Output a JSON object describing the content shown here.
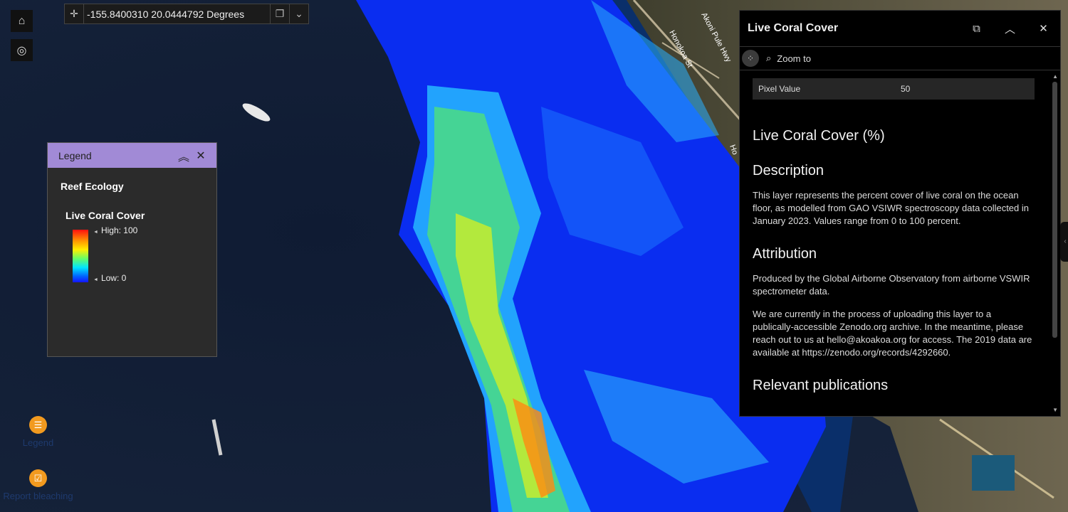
{
  "map": {
    "coordinates": "-155.8400310 20.0444792 Degrees",
    "street_labels": [
      "Honokoa St",
      "Akoni Pule Hwy",
      "Ho"
    ]
  },
  "legend": {
    "title": "Legend",
    "layer_group": "Reef Ecology",
    "layer_name": "Live Coral Cover",
    "high_label": "High: 100",
    "low_label": "Low: 0"
  },
  "side_actions": {
    "legend_label": "Legend",
    "report_label": "Report bleaching"
  },
  "panel": {
    "title": "Live Coral Cover",
    "zoom_label": "Zoom to",
    "pixel_key": "Pixel Value",
    "pixel_value": "50",
    "heading": "Live Coral Cover (%)",
    "description_heading": "Description",
    "description_text": "This layer represents the percent cover of live coral on the ocean floor, as modelled from GAO VSIWR spectroscopy data collected in January 2023. Values range from 0 to 100 percent.",
    "attribution_heading": "Attribution",
    "attribution_text_1": "Produced by the Global Airborne Observatory from airborne VSWIR spectrometer data.",
    "attribution_text_2": "We are currently in the process of uploading this layer to a publically-accessible Zenodo.org archive. In the meantime, please reach out to us at hello@akoakoa.org for access. The 2019 data are available at https://zenodo.org/records/4292660.",
    "publications_heading": "Relevant publications"
  },
  "colors": {
    "legend_header": "#a18ad6",
    "action_orange": "#f29a1f",
    "panel_bg": "#000000"
  },
  "icons": [
    "home-icon",
    "locate-icon",
    "crosshair-icon",
    "copy-icon",
    "chevron-down-icon",
    "expand-collapse-icon",
    "close-icon",
    "dock-icon",
    "grid-icon",
    "zoom-icon",
    "list-icon",
    "checklist-icon"
  ]
}
